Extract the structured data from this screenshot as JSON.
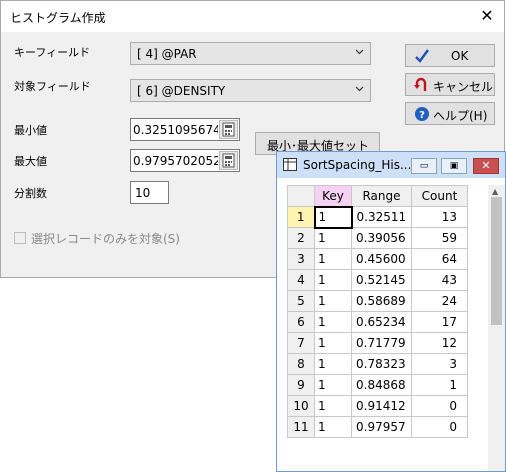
{
  "dialog": {
    "title": "ヒストグラム作成",
    "close_glyph": "✕",
    "key_field": {
      "label": "キーフィールド",
      "value": "[ 4] @PAR"
    },
    "target_field": {
      "label": "対象フィールド",
      "value": "[ 6] @DENSITY"
    },
    "min": {
      "label": "最小値",
      "value": "0.3251095674"
    },
    "max": {
      "label": "最大値",
      "value": "0.9795702052"
    },
    "divisions": {
      "label": "分割数",
      "value": "10"
    },
    "set_minmax_button": "最小･最大値セット",
    "ok_button": "OK",
    "cancel_button": "キャンセル",
    "help_button": "ヘルプ(H)",
    "selected_only_checkbox": "選択レコードのみを対象(S)"
  },
  "grid_window": {
    "title": "SortSpacing_His...",
    "minimize_glyph": "▭",
    "maximize_glyph": "▣",
    "close_glyph": "✕",
    "columns": [
      "Key",
      "Range",
      "Count"
    ],
    "rows": [
      {
        "num": "1",
        "key": "1",
        "range": "0.32511",
        "count": "13"
      },
      {
        "num": "2",
        "key": "1",
        "range": "0.39056",
        "count": "59"
      },
      {
        "num": "3",
        "key": "1",
        "range": "0.45600",
        "count": "64"
      },
      {
        "num": "4",
        "key": "1",
        "range": "0.52145",
        "count": "43"
      },
      {
        "num": "5",
        "key": "1",
        "range": "0.58689",
        "count": "24"
      },
      {
        "num": "6",
        "key": "1",
        "range": "0.65234",
        "count": "17"
      },
      {
        "num": "7",
        "key": "1",
        "range": "0.71779",
        "count": "12"
      },
      {
        "num": "8",
        "key": "1",
        "range": "0.78323",
        "count": "3"
      },
      {
        "num": "9",
        "key": "1",
        "range": "0.84868",
        "count": "1"
      },
      {
        "num": "10",
        "key": "1",
        "range": "0.91412",
        "count": "0"
      },
      {
        "num": "11",
        "key": "1",
        "range": "0.97957",
        "count": "0"
      }
    ]
  }
}
